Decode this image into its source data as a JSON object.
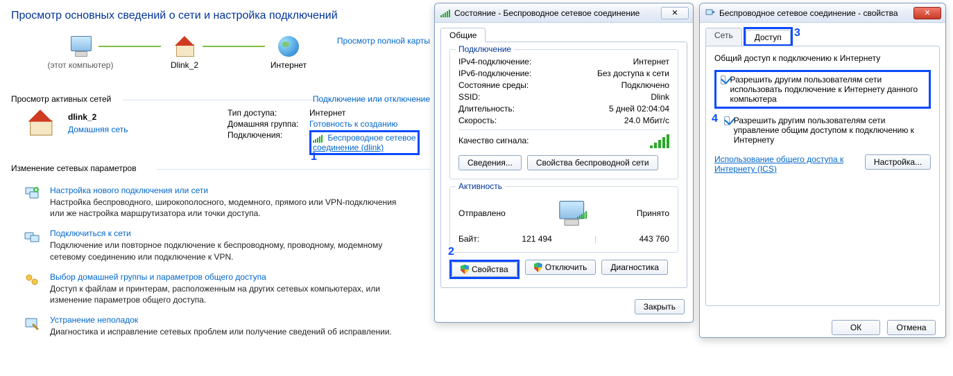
{
  "left": {
    "title": "Просмотр основных сведений о сети и настройка подключений",
    "full_map": "Просмотр полной карты",
    "node_pc": "(этот компьютер)",
    "node_router": "Dlink_2",
    "node_net": "Интернет",
    "active_hdr": "Просмотр активных сетей",
    "connect_link": "Подключение или отключение",
    "net_name": "dlink_2",
    "home_net": "Домашняя сеть",
    "lbl_access": "Тип доступа:",
    "val_access": "Интернет",
    "lbl_homegrp": "Домашняя группа:",
    "val_homegrp": "Готовность к созданию",
    "lbl_conn": "Подключения:",
    "val_conn1": "Беспроводное сетевое",
    "val_conn2": "соединение (dlink)",
    "num1": "1",
    "change_hdr": "Изменение сетевых параметров",
    "t1": "Настройка нового подключения или сети",
    "t1d": "Настройка беспроводного, широкополосного, модемного, прямого или VPN-подключения или же настройка маршрутизатора или точки доступа.",
    "t2": "Подключиться к сети",
    "t2d": "Подключение или повторное подключение к беспроводному, проводному, модемному сетевому соединению или подключение к VPN.",
    "t3": "Выбор домашней группы и параметров общего доступа",
    "t3d": "Доступ к файлам и принтерам, расположенным на других сетевых компьютерах, или изменение параметров общего доступа.",
    "t4": "Устранение неполадок",
    "t4d": "Диагностика и исправление сетевых проблем или получение сведений об исправлении."
  },
  "dlg1": {
    "title": "Состояние - Беспроводное сетевое соединение",
    "tab": "Общие",
    "gb_conn": "Подключение",
    "k_ipv4": "IPv4-подключение:",
    "v_ipv4": "Интернет",
    "k_ipv6": "IPv6-подключение:",
    "v_ipv6": "Без доступа к сети",
    "k_media": "Состояние среды:",
    "v_media": "Подключено",
    "k_ssid": "SSID:",
    "v_ssid": "Dlink",
    "k_dur": "Длительность:",
    "v_dur": "5 дней 02:04:04",
    "k_spd": "Скорость:",
    "v_spd": "24.0 Мбит/с",
    "k_qual": "Качество сигнала:",
    "btn_details": "Сведения...",
    "btn_wprops": "Свойства беспроводной сети",
    "gb_act": "Активность",
    "sent": "Отправлено",
    "recv": "Принято",
    "bytes_lbl": "Байт:",
    "bytes_sent": "121 494",
    "bytes_recv": "443 760",
    "btn_props": "Свойства",
    "btn_disable": "Отключить",
    "btn_diag": "Диагностика",
    "btn_close": "Закрыть",
    "num2": "2"
  },
  "dlg2": {
    "title": "Беспроводное сетевое соединение - свойства",
    "tab_net": "Сеть",
    "tab_acc": "Доступ",
    "num3": "3",
    "gb": "Общий доступ к подключению к Интернету",
    "chk1": "Разрешить другим пользователям сети использовать подключение к Интернету данного компьютера",
    "chk2": "Разрешить другим пользователям сети управление общим доступом к подключению к Интернету",
    "num4": "4",
    "ics_link1": "Использование общего доступа к",
    "ics_link2": "Интернету (ICS)",
    "btn_settings": "Настройка...",
    "btn_ok": "ОК",
    "btn_cancel": "Отмена"
  }
}
